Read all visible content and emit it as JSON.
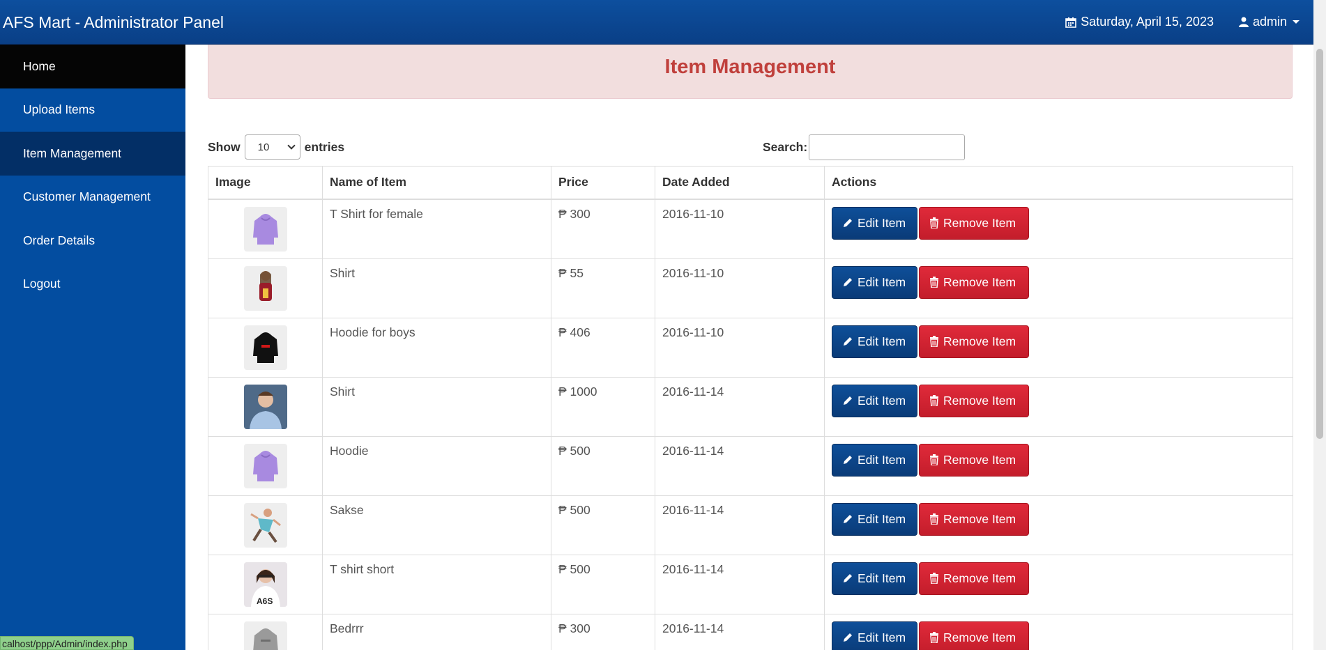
{
  "app": {
    "title": "AFS Mart - Administrator Panel"
  },
  "header": {
    "date": "Saturday, April 15, 2023",
    "user": "admin"
  },
  "sidebar": {
    "items": [
      {
        "label": "Home"
      },
      {
        "label": "Upload Items"
      },
      {
        "label": "Item Management"
      },
      {
        "label": "Customer Management"
      },
      {
        "label": "Order Details"
      },
      {
        "label": "Logout"
      }
    ]
  },
  "page": {
    "title": "Item Management"
  },
  "controls": {
    "show_label": "Show",
    "entries_value": "10",
    "entries_label": "entries",
    "search_label": "Search:",
    "search_value": ""
  },
  "table": {
    "headers": [
      "Image",
      "Name of Item",
      "Price",
      "Date Added",
      "Actions"
    ],
    "edit_label": "Edit Item",
    "remove_label": "Remove Item",
    "rows": [
      {
        "name": "T Shirt for female",
        "price": "₱ 300",
        "date": "2016-11-10",
        "thumb": "purple-hoodie"
      },
      {
        "name": "Shirt",
        "price": "₱ 55",
        "date": "2016-11-10",
        "thumb": "woman-red-top"
      },
      {
        "name": "Hoodie for boys",
        "price": "₱ 406",
        "date": "2016-11-10",
        "thumb": "black-hoodie"
      },
      {
        "name": "Shirt",
        "price": "₱ 1000",
        "date": "2016-11-14",
        "thumb": "man-blue-shirt"
      },
      {
        "name": "Hoodie",
        "price": "₱ 500",
        "date": "2016-11-14",
        "thumb": "purple-hoodie"
      },
      {
        "name": "Sakse",
        "price": "₱ 500",
        "date": "2016-11-14",
        "thumb": "jumping-woman"
      },
      {
        "name": "T shirt short",
        "price": "₱ 500",
        "date": "2016-11-14",
        "thumb": "woman-white-tee"
      },
      {
        "name": "Bedrrr",
        "price": "₱ 300",
        "date": "2016-11-14",
        "thumb": "grey-hoodie"
      }
    ]
  },
  "status_bar": {
    "url": "calhost/ppp/Admin/index.php"
  },
  "colors": {
    "header": "#0a3f86",
    "sidebar": "#034da0",
    "edit": "#0a3b78",
    "remove": "#d0202f",
    "banner": "#f2dede",
    "banner_text": "#c0403c"
  }
}
